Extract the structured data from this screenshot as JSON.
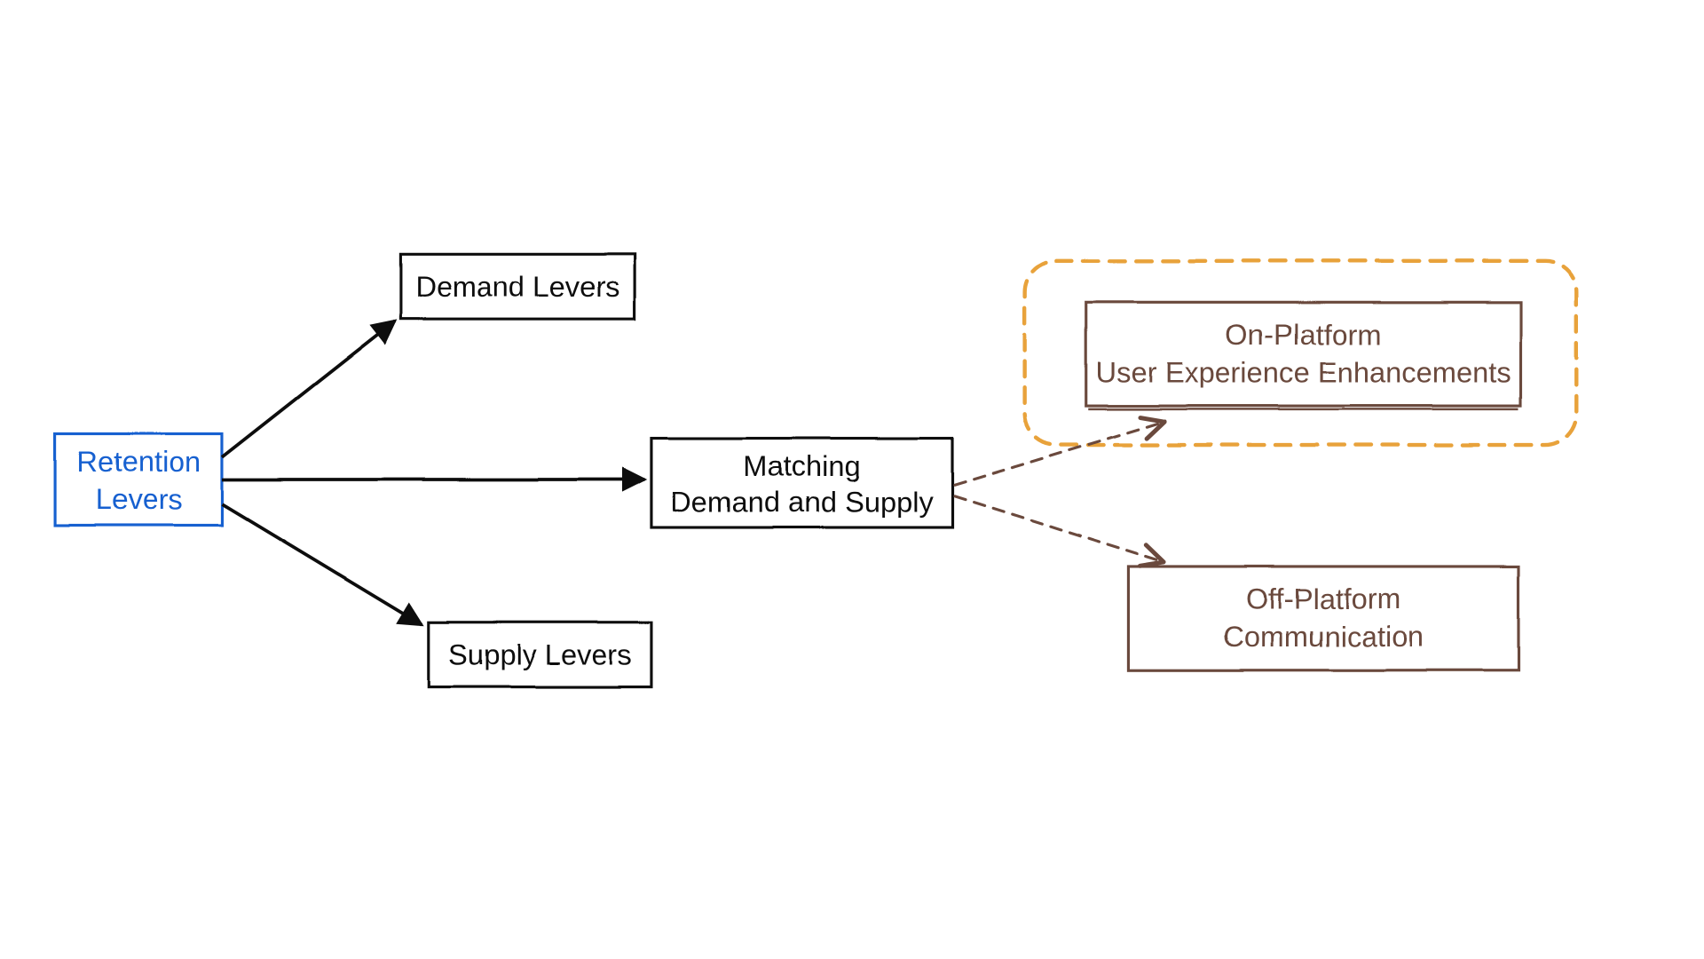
{
  "nodes": {
    "root": {
      "line1": "Retention",
      "line2": "Levers"
    },
    "demand": {
      "line1": "Demand Levers"
    },
    "supply": {
      "line1": "Supply Levers"
    },
    "matching": {
      "line1": "Matching",
      "line2": "Demand and Supply"
    },
    "onplat": {
      "line1": "On-Platform",
      "line2": "User Experience Enhancements"
    },
    "offplat": {
      "line1": "Off-Platform",
      "line2": "Communication"
    }
  },
  "colors": {
    "black": "#111111",
    "blue": "#1860d0",
    "brown": "#6b4a3c",
    "orange": "#e8a23a"
  }
}
